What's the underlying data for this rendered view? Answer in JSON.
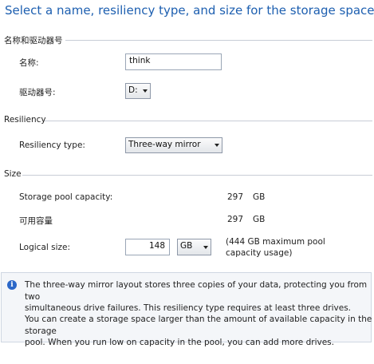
{
  "header": {
    "title": "Select a name, resiliency type, and size for the storage space"
  },
  "name_section": {
    "heading": "名称和驱动器号",
    "name_label": "名称:",
    "name_value": "think",
    "drive_label": "驱动器号:",
    "drive_value": "D:"
  },
  "resiliency_section": {
    "heading": "Resiliency",
    "type_label": "Resiliency type:",
    "type_value": "Three-way mirror"
  },
  "size_section": {
    "heading": "Size",
    "pool_capacity_label": "Storage pool capacity:",
    "pool_capacity_value": "297",
    "pool_capacity_unit": "GB",
    "available_label": "可用容量",
    "available_value": "297",
    "available_unit": "GB",
    "logical_label": "Logical size:",
    "logical_value": "148",
    "logical_unit": "GB",
    "max_note_line1": "(444 GB maximum pool",
    "max_note_line2": "capacity usage)"
  },
  "info": {
    "icon": "info-icon",
    "line1": "The three-way mirror layout stores three copies of your data, protecting you from two",
    "line2": "simultaneous drive failures. This resiliency type requires at least three drives.",
    "line3": "You can create a storage space larger than the amount of available capacity in the storage",
    "line4": "pool. When you run low on capacity in the pool, you can add more drives."
  },
  "colors": {
    "title": "#1d5fb0",
    "info_icon": "#2b67c8",
    "info_bg": "#f4f6f9"
  }
}
